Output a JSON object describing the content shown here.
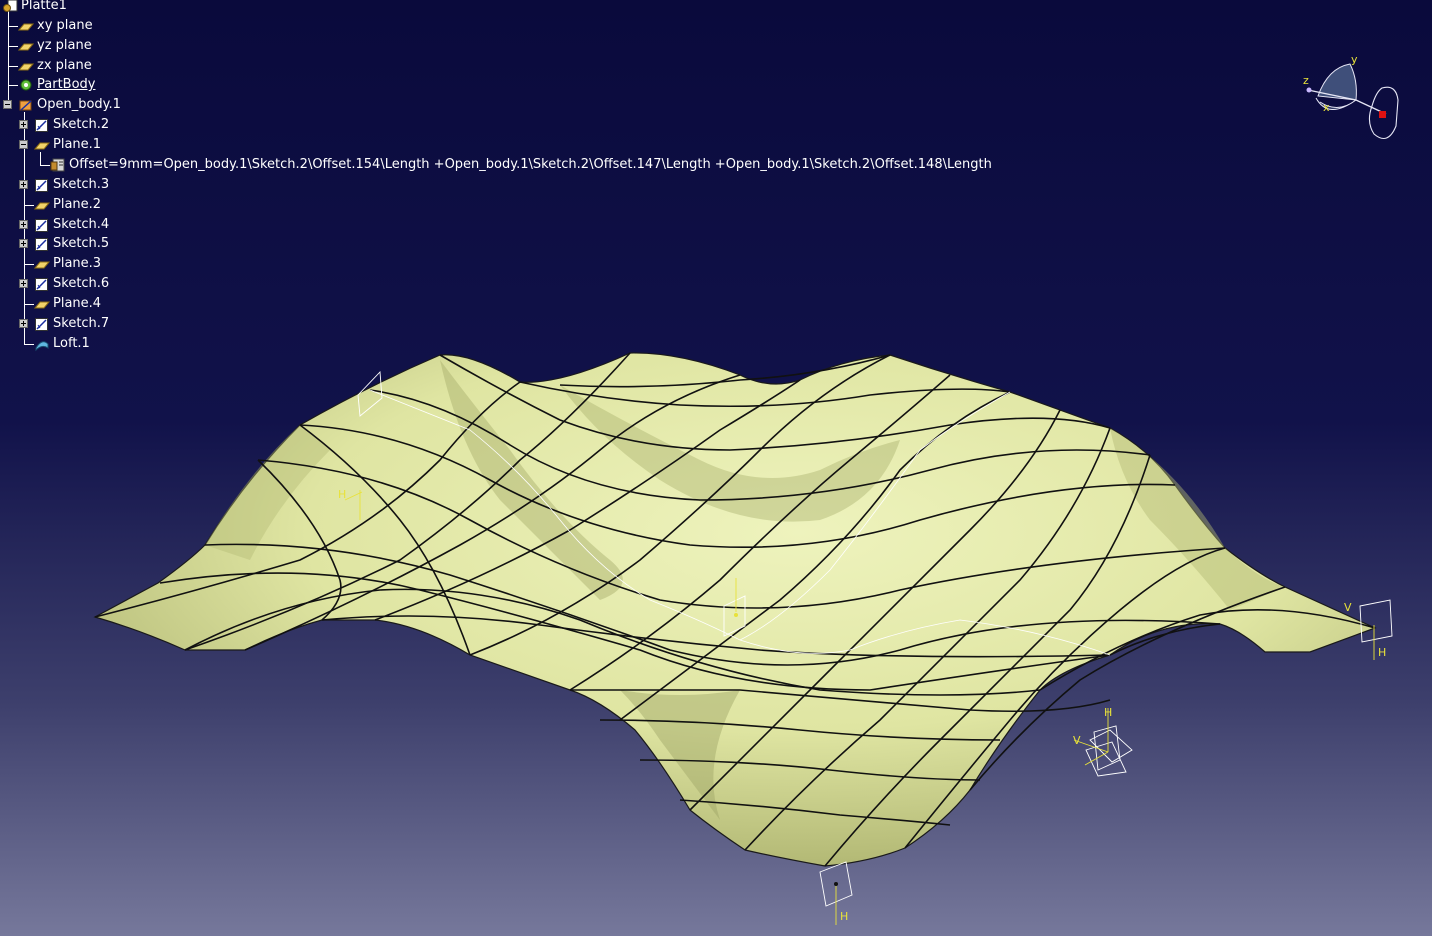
{
  "tree": {
    "root": "Platte1",
    "items": [
      {
        "label": "xy plane",
        "icon": "plane-icon"
      },
      {
        "label": "yz plane",
        "icon": "plane-icon"
      },
      {
        "label": "zx plane",
        "icon": "plane-icon"
      },
      {
        "label": "PartBody",
        "icon": "partbody-icon"
      },
      {
        "label": "Open_body.1",
        "icon": "open-body-icon"
      },
      {
        "label": "Sketch.2",
        "icon": "sketch-icon"
      },
      {
        "label": "Plane.1",
        "icon": "plane-icon"
      },
      {
        "label": "Offset=9mm=Open_body.1\\Sketch.2\\Offset.154\\Length +Open_body.1\\Sketch.2\\Offset.147\\Length +Open_body.1\\Sketch.2\\Offset.148\\Length",
        "icon": "formula-icon"
      },
      {
        "label": "Sketch.3",
        "icon": "sketch-icon"
      },
      {
        "label": "Plane.2",
        "icon": "plane-icon"
      },
      {
        "label": "Sketch.4",
        "icon": "sketch-icon"
      },
      {
        "label": "Sketch.5",
        "icon": "sketch-icon"
      },
      {
        "label": "Plane.3",
        "icon": "plane-icon"
      },
      {
        "label": "Sketch.6",
        "icon": "sketch-icon"
      },
      {
        "label": "Plane.4",
        "icon": "plane-icon"
      },
      {
        "label": "Sketch.7",
        "icon": "sketch-icon"
      },
      {
        "label": "Loft.1",
        "icon": "loft-icon"
      }
    ]
  },
  "compass": {
    "x_label": "x",
    "y_label": "y",
    "z_label": "z"
  },
  "sketch_axis": {
    "h_label": "H",
    "v_label": "V"
  },
  "colors": {
    "surface": "#e2e8a6",
    "surface_shade": "#b9c17e",
    "mesh_line": "#111111",
    "axis_yellow": "#e8e23a",
    "background_top": "#0a0a3c",
    "background_bottom": "#76789b"
  }
}
